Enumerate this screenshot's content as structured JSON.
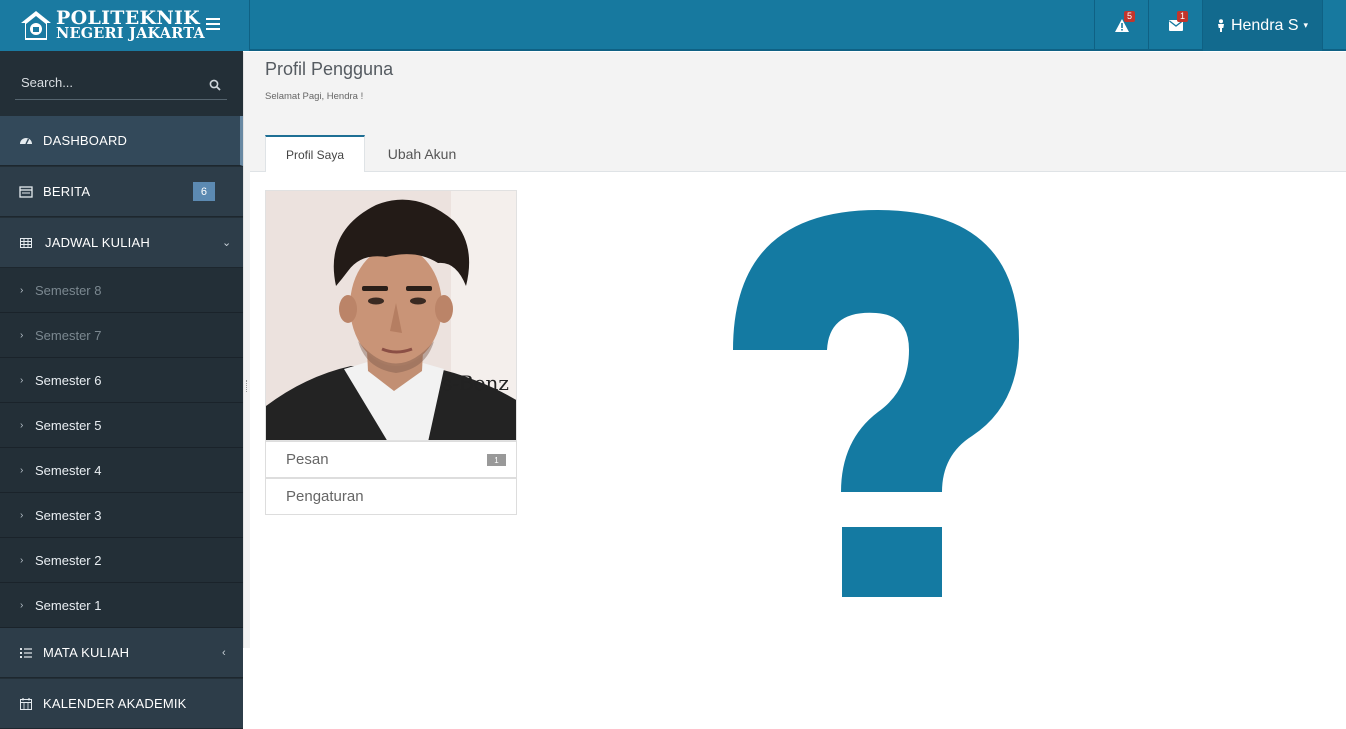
{
  "brand": {
    "line1": "POLITEKNIK",
    "line2": "NEGERI JAKARTA"
  },
  "header": {
    "alert_count": "5",
    "mail_count": "1",
    "user_name": "Hendra  S",
    "accent": "#17799f"
  },
  "sidebar": {
    "search_placeholder": "Search...",
    "items": [
      {
        "label": "DASHBOARD",
        "icon": "dashboard-icon"
      },
      {
        "label": "BERITA",
        "icon": "news-icon",
        "count": "6"
      },
      {
        "label": "JADWAL KULIAH",
        "icon": "table-icon"
      },
      {
        "label": "MATA KULIAH",
        "icon": "list-icon"
      },
      {
        "label": "KALENDER AKADEMIK",
        "icon": "calendar-icon"
      }
    ],
    "semesters": [
      "Semester 8",
      "Semester 7",
      "Semester 6",
      "Semester 5",
      "Semester 4",
      "Semester 3",
      "Semester 2",
      "Semester 1"
    ]
  },
  "main": {
    "title": "Profil Pengguna",
    "greeting": "Selamat Pagi, Hendra !",
    "tabs": [
      "Profil Saya",
      "Ubah Akun"
    ],
    "menu": [
      {
        "label": "Pesan",
        "count": "1"
      },
      {
        "label": "Pengaturan"
      }
    ],
    "photo_caption": "s-Benz"
  }
}
